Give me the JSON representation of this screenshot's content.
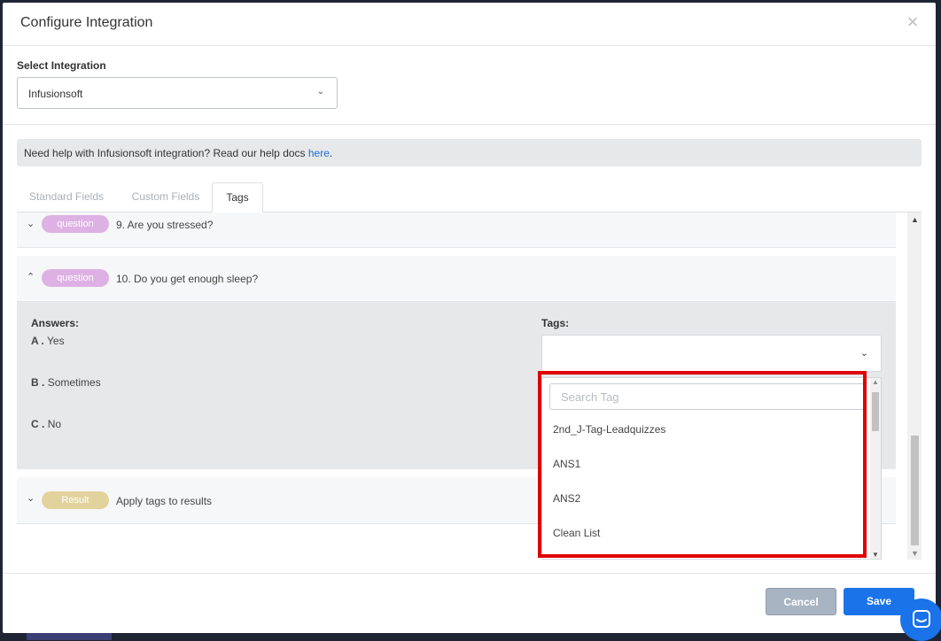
{
  "modal": {
    "title": "Configure Integration",
    "close_icon": "close-icon"
  },
  "integration": {
    "label": "Select Integration",
    "value": "Infusionsoft"
  },
  "help": {
    "text": "Need help with Infusionsoft integration? Read our help docs ",
    "link": "here",
    "after": "."
  },
  "tabs": [
    {
      "label": "Standard Fields",
      "active": false
    },
    {
      "label": "Custom Fields",
      "active": false
    },
    {
      "label": "Tags",
      "active": true
    }
  ],
  "questions": [
    {
      "badge": "question",
      "text": "9. Are you stressed?",
      "expanded": false
    },
    {
      "badge": "question",
      "text": "10. Do you get enough sleep?",
      "expanded": true
    }
  ],
  "answers": {
    "label": "Answers:",
    "items": [
      {
        "key": "A .",
        "text": "Yes"
      },
      {
        "key": "B .",
        "text": "Sometimes"
      },
      {
        "key": "C .",
        "text": "No"
      }
    ]
  },
  "tags": {
    "label": "Tags:",
    "search_placeholder": "Search Tag",
    "options": [
      "2nd_J-Tag-Leadquizzes",
      "ANS1",
      "ANS2",
      "Clean List"
    ]
  },
  "result": {
    "badge": "Result",
    "text": "Apply tags to results"
  },
  "footer": {
    "cancel": "Cancel",
    "save": "Save"
  },
  "colors": {
    "primary": "#1a73e8",
    "question_badge": "#ddb1e3",
    "result_badge": "#e2d39c",
    "highlight": "#e00000"
  }
}
